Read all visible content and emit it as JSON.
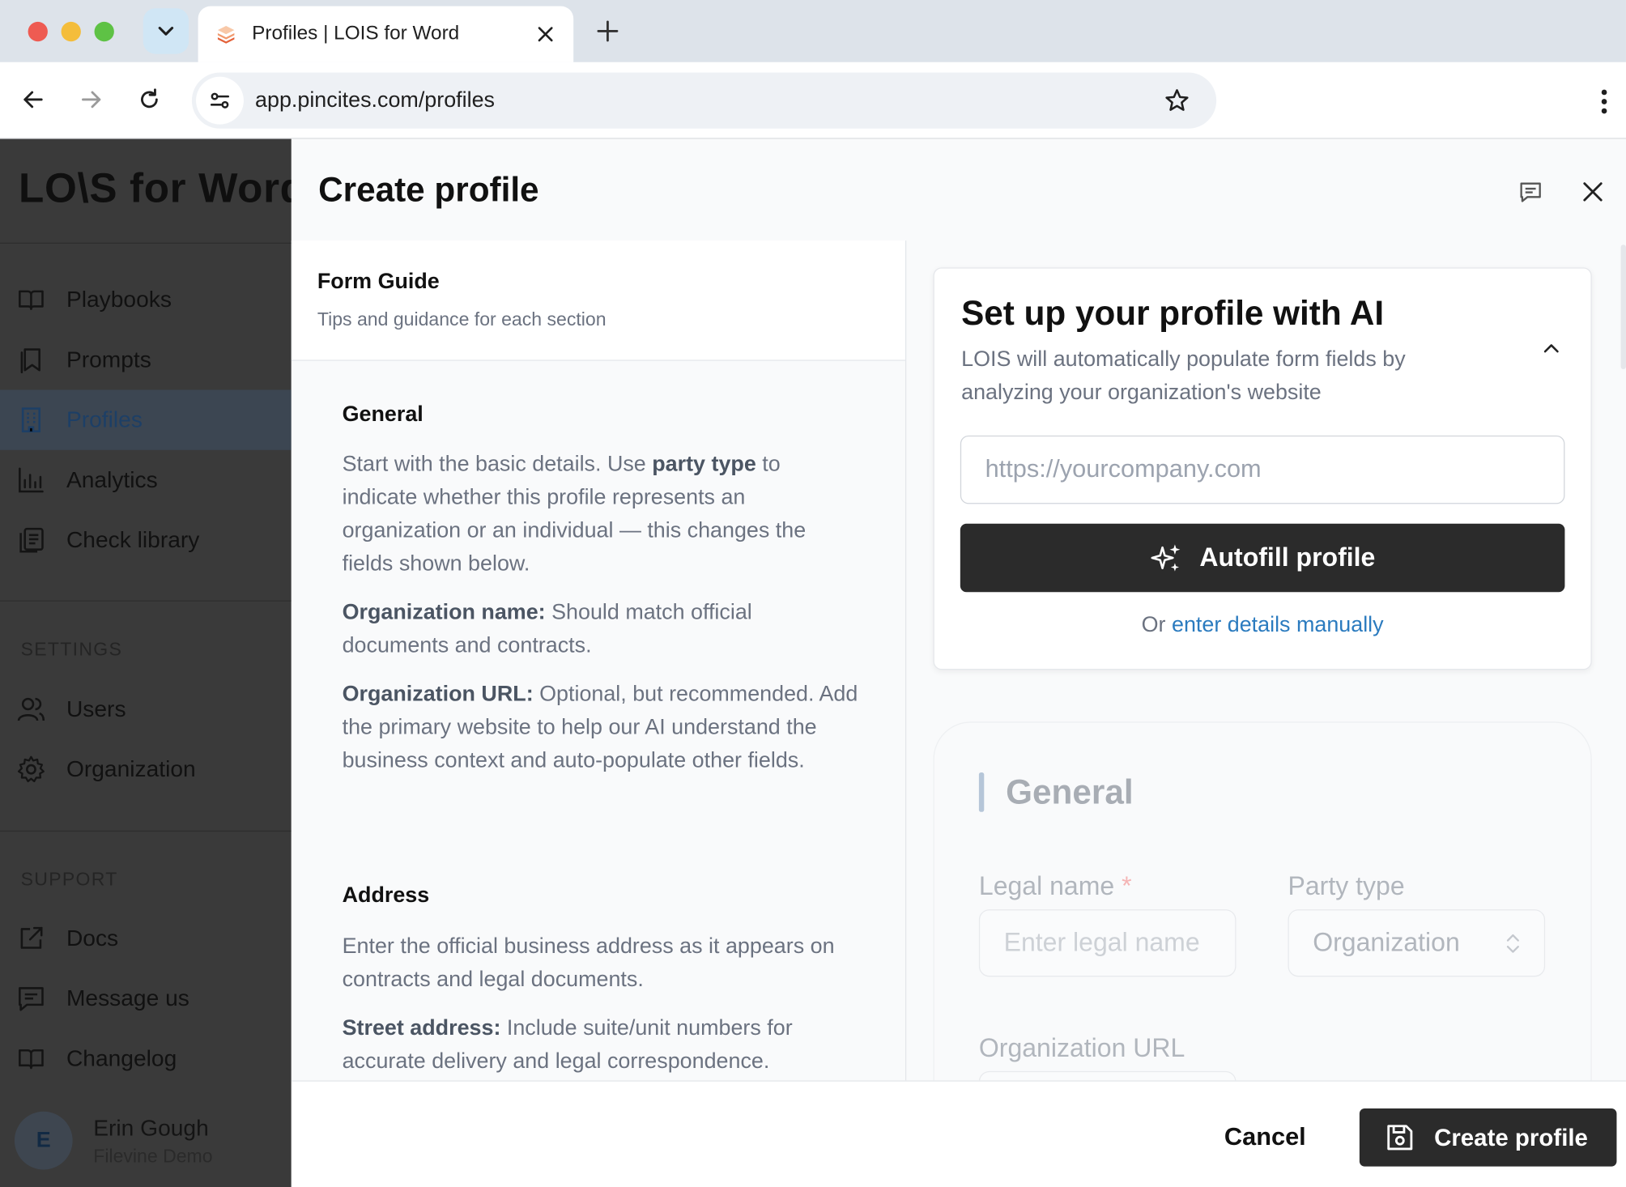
{
  "browser": {
    "tab_title": "Profiles | LOIS for Word",
    "url": "app.pincites.com/profiles"
  },
  "sidebar": {
    "logo": "LO\\S for Word",
    "nav": [
      {
        "label": "Playbooks",
        "icon": "book-open-icon"
      },
      {
        "label": "Prompts",
        "icon": "bookmark-icon"
      },
      {
        "label": "Profiles",
        "icon": "building-icon",
        "active": true
      },
      {
        "label": "Analytics",
        "icon": "bar-chart-icon"
      },
      {
        "label": "Check library",
        "icon": "library-icon"
      }
    ],
    "settings_heading": "SETTINGS",
    "settings": [
      {
        "label": "Users",
        "icon": "users-icon"
      },
      {
        "label": "Organization",
        "icon": "gear-icon"
      }
    ],
    "support_heading": "SUPPORT",
    "support": [
      {
        "label": "Docs",
        "icon": "external-link-icon"
      },
      {
        "label": "Message us",
        "icon": "message-icon"
      },
      {
        "label": "Changelog",
        "icon": "book-open-icon"
      }
    ],
    "user": {
      "initial": "E",
      "name": "Erin Gough",
      "org": "Filevine Demo"
    }
  },
  "modal": {
    "title": "Create profile",
    "guide": {
      "heading": "Form Guide",
      "subheading": "Tips and guidance for each section",
      "general_heading": "General",
      "general_p1_a": "Start with the basic details. Use ",
      "general_p1_b": "party type",
      "general_p1_c": " to indicate whether this profile represents an organization or an individual — this changes the fields shown below.",
      "general_p2_a": "Organization name:",
      "general_p2_b": " Should match official documents and contracts.",
      "general_p3_a": "Organization URL:",
      "general_p3_b": " Optional, but recommended. Add the primary website to help our AI understand the business context and auto-populate other fields.",
      "address_heading": "Address",
      "address_p1": "Enter the official business address as it appears on contracts and legal documents.",
      "address_p2_a": "Street address:",
      "address_p2_b": " Include suite/unit numbers for accurate delivery and legal correspondence."
    },
    "ai": {
      "title": "Set up your profile with AI",
      "subtitle": "LOIS will automatically populate form fields by analyzing your organization's website",
      "url_placeholder": "https://yourcompany.com",
      "autofill_label": "Autofill profile",
      "or_text": "Or ",
      "manual_link": "enter details manually"
    },
    "general": {
      "title": "General",
      "legal_name_label": "Legal name",
      "required_mark": "*",
      "legal_name_placeholder": "Enter legal name",
      "party_type_label": "Party type",
      "party_type_value": "Organization",
      "org_url_label": "Organization URL"
    },
    "footer": {
      "cancel_label": "Cancel",
      "create_label": "Create profile"
    }
  }
}
